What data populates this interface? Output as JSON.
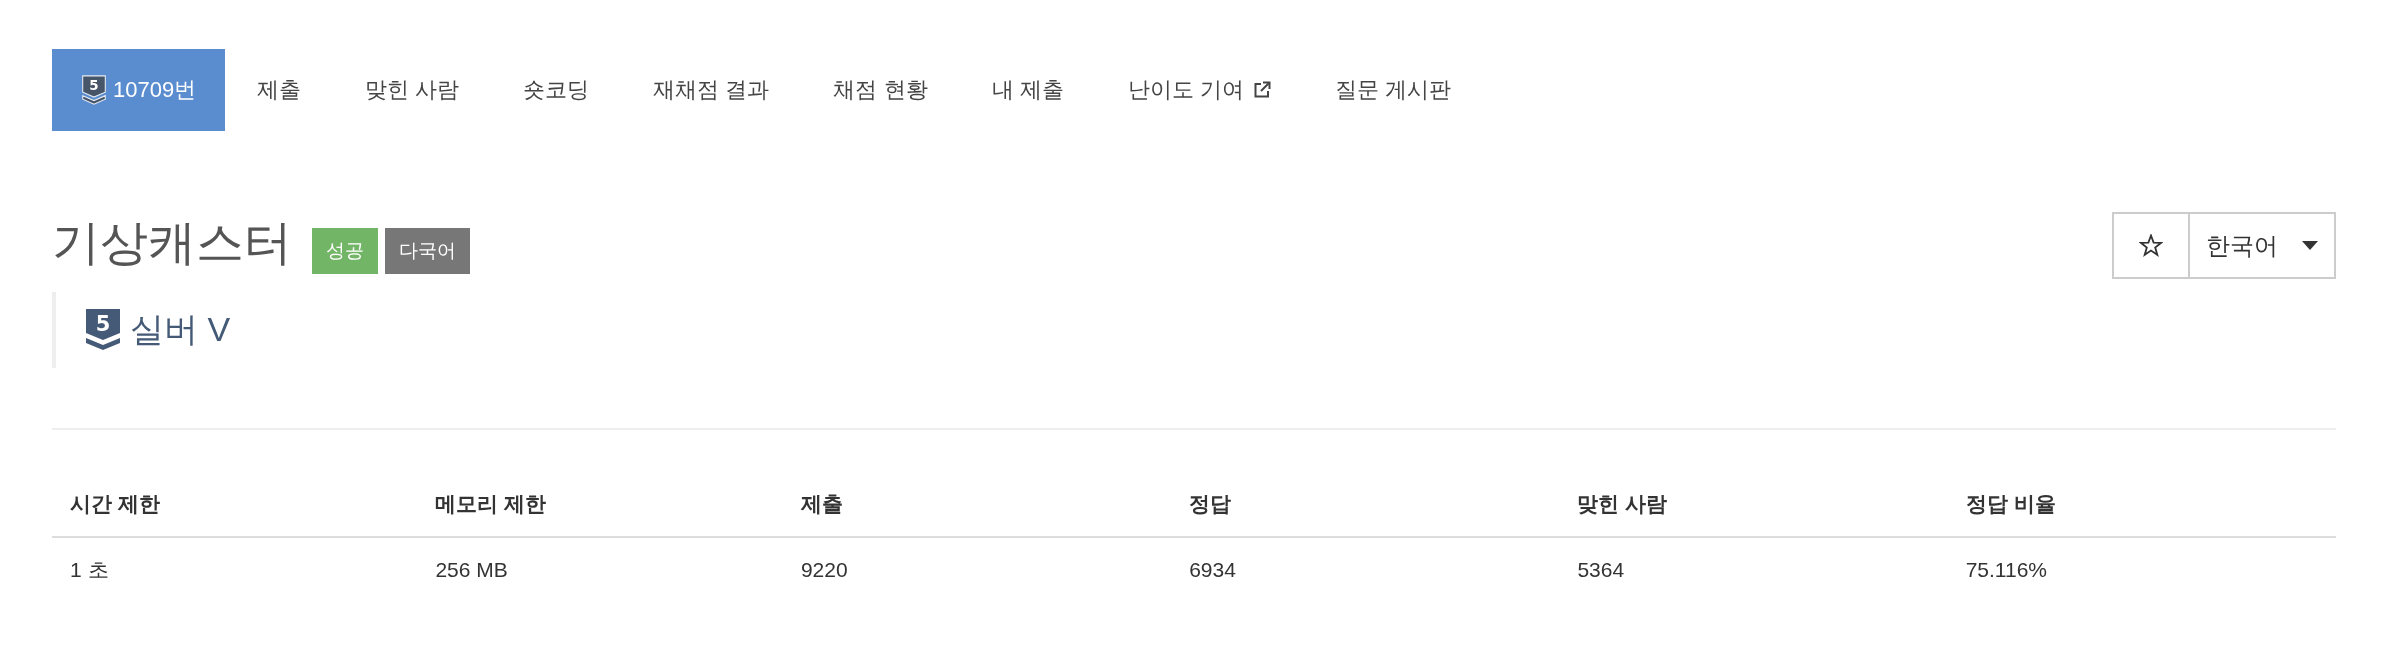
{
  "nav": {
    "tabs": [
      {
        "kind": "problem",
        "tier": "5",
        "label": "10709번",
        "selected": true,
        "external": false
      },
      {
        "kind": "link",
        "label": "제출",
        "selected": false,
        "external": false
      },
      {
        "kind": "link",
        "label": "맞힌 사람",
        "selected": false,
        "external": false
      },
      {
        "kind": "link",
        "label": "숏코딩",
        "selected": false,
        "external": false
      },
      {
        "kind": "link",
        "label": "재채점 결과",
        "selected": false,
        "external": false
      },
      {
        "kind": "link",
        "label": "채점 현황",
        "selected": false,
        "external": false
      },
      {
        "kind": "link",
        "label": "내 제출",
        "selected": false,
        "external": false
      },
      {
        "kind": "link",
        "label": "난이도 기여",
        "selected": false,
        "external": true
      },
      {
        "kind": "link",
        "label": "질문 게시판",
        "selected": false,
        "external": false
      }
    ]
  },
  "problem": {
    "title": "기상캐스터",
    "labels": [
      {
        "text": "성공",
        "color": "#73b566"
      },
      {
        "text": "다국어",
        "color": "#777777"
      }
    ],
    "tier": {
      "number": "5",
      "name": "실버 V"
    },
    "starred": false,
    "language": "한국어"
  },
  "info_table": {
    "columns": [
      "시간 제한",
      "메모리 제한",
      "제출",
      "정답",
      "맞힌 사람",
      "정답 비율"
    ],
    "rows": [
      [
        "1 초",
        "256 MB",
        "9220",
        "6934",
        "5364",
        "75.116%"
      ]
    ]
  }
}
